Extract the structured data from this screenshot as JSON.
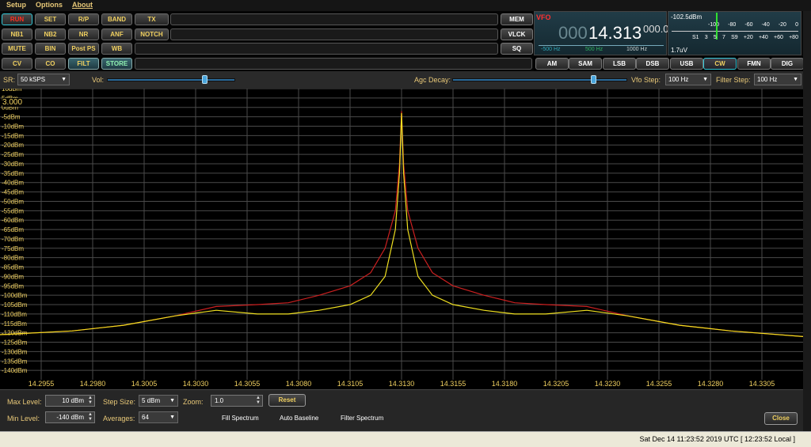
{
  "menu": [
    "Setup",
    "Options",
    "About"
  ],
  "controls": {
    "row1": [
      "RUN",
      "SET",
      "R/P",
      "BAND",
      "TX"
    ],
    "row2": [
      "NB1",
      "NB2",
      "NR",
      "ANF",
      "NOTCH"
    ],
    "row3": [
      "MUTE",
      "BIN",
      "Post PS",
      "WB"
    ],
    "row4": [
      "CV",
      "CO",
      "FILT",
      "STORE"
    ],
    "right": [
      "MEM",
      "VLCK",
      "SQ"
    ]
  },
  "vfo": {
    "label": "VFO",
    "dim": "000",
    "freq": "14.313",
    "sub": "000.0",
    "marks": [
      "-500 Hz",
      "500 Hz",
      "1000 Hz"
    ]
  },
  "smeter": {
    "level": "-102.5dBm",
    "top_scale": [
      "-100",
      "-80",
      "-60",
      "-40",
      "-20",
      "0"
    ],
    "bottom_scale": [
      "S1",
      "3",
      "5",
      "7",
      "S9",
      "+20",
      "+40",
      "+60",
      "+80"
    ],
    "uv": "1.7uV"
  },
  "modes": [
    "AM",
    "SAM",
    "LSB",
    "DSB",
    "USB",
    "CW",
    "FMN",
    "DIG"
  ],
  "active_mode": "CW",
  "ctrl": {
    "sr_label": "SR:",
    "sr_value": "50 kSPS",
    "vol_label": "Vol:",
    "agc_label": "Agc Decay:",
    "vfo_step_label": "Vfo Step:",
    "vfo_step": "100 Hz",
    "filter_step_label": "Filter Step:",
    "filter_step": "100 Hz"
  },
  "levels": {
    "vol": 0.75,
    "agc": 0.8
  },
  "bottom": {
    "max_level_label": "Max Level:",
    "max_level": "10 dBm",
    "min_level_label": "Min Level:",
    "min_level": "-140 dBm",
    "step_size_label": "Step Size:",
    "step_size": "5 dBm",
    "averages_label": "Averages:",
    "averages": "64",
    "zoom_label": "Zoom:",
    "zoom": "1.0",
    "reset": "Reset",
    "fill_spectrum": "Fill Spectrum",
    "auto_baseline": "Auto Baseline",
    "filter_spectrum": "Filter Spectrum",
    "close": "Close"
  },
  "status": "Sat Dec 14 11:23:52 2019 UTC [ 12:23:52 Local ]",
  "colors": {
    "accent": "#f0d060",
    "trace_peak": "#cc2020",
    "trace_avg": "#f0e020",
    "grid": "#4a4a4a"
  },
  "chart_data": {
    "type": "line",
    "marker_value": "3.000",
    "ylim": [
      -145,
      10
    ],
    "xlim": [
      14.2935,
      14.3325
    ],
    "y_ticks": [
      "10dBm",
      "5dBm",
      "0dBm",
      "-5dBm",
      "-10dBm",
      "-15dBm",
      "-20dBm",
      "-25dBm",
      "-30dBm",
      "-35dBm",
      "-40dBm",
      "-45dBm",
      "-50dBm",
      "-55dBm",
      "-60dBm",
      "-65dBm",
      "-70dBm",
      "-75dBm",
      "-80dBm",
      "-85dBm",
      "-90dBm",
      "-95dBm",
      "-100dBm",
      "-105dBm",
      "-110dBm",
      "-115dBm",
      "-120dBm",
      "-125dBm",
      "-130dBm",
      "-135dBm",
      "-140dBm"
    ],
    "x_ticks": [
      "14.2955",
      "14.2980",
      "14.3005",
      "14.3030",
      "14.3055",
      "14.3080",
      "14.3105",
      "14.3130",
      "14.3155",
      "14.3180",
      "14.3205",
      "14.3230",
      "14.3255",
      "14.3280",
      "14.3305"
    ],
    "x_values": [
      14.2955,
      14.298,
      14.3005,
      14.303,
      14.3055,
      14.308,
      14.3105,
      14.313,
      14.3155,
      14.318,
      14.3205,
      14.323,
      14.3255,
      14.328,
      14.3305
    ],
    "series": [
      {
        "color": "#cc2020",
        "points": [
          [
            14.2935,
            -121
          ],
          [
            14.297,
            -119
          ],
          [
            14.2995,
            -116
          ],
          [
            14.302,
            -111
          ],
          [
            14.304,
            -106
          ],
          [
            14.306,
            -105
          ],
          [
            14.3075,
            -104
          ],
          [
            14.309,
            -100
          ],
          [
            14.3105,
            -95
          ],
          [
            14.3115,
            -88
          ],
          [
            14.3122,
            -75
          ],
          [
            14.3127,
            -55
          ],
          [
            14.3129,
            -30
          ],
          [
            14.313,
            -2
          ],
          [
            14.3131,
            -30
          ],
          [
            14.3133,
            -55
          ],
          [
            14.3138,
            -75
          ],
          [
            14.3145,
            -88
          ],
          [
            14.3155,
            -95
          ],
          [
            14.317,
            -100
          ],
          [
            14.3185,
            -104
          ],
          [
            14.32,
            -105
          ],
          [
            14.322,
            -106
          ],
          [
            14.324,
            -111
          ],
          [
            14.3265,
            -116
          ],
          [
            14.329,
            -119
          ],
          [
            14.3325,
            -122
          ]
        ]
      },
      {
        "color": "#f0e020",
        "points": [
          [
            14.2935,
            -121
          ],
          [
            14.297,
            -119
          ],
          [
            14.2995,
            -116
          ],
          [
            14.302,
            -111
          ],
          [
            14.304,
            -108
          ],
          [
            14.306,
            -110
          ],
          [
            14.3075,
            -110
          ],
          [
            14.309,
            -108
          ],
          [
            14.3105,
            -105
          ],
          [
            14.3115,
            -100
          ],
          [
            14.3122,
            -90
          ],
          [
            14.3127,
            -65
          ],
          [
            14.3129,
            -35
          ],
          [
            14.313,
            -3
          ],
          [
            14.3131,
            -35
          ],
          [
            14.3133,
            -65
          ],
          [
            14.3138,
            -90
          ],
          [
            14.3145,
            -100
          ],
          [
            14.3155,
            -105
          ],
          [
            14.317,
            -108
          ],
          [
            14.3185,
            -110
          ],
          [
            14.32,
            -110
          ],
          [
            14.322,
            -108
          ],
          [
            14.324,
            -111
          ],
          [
            14.3265,
            -116
          ],
          [
            14.329,
            -119
          ],
          [
            14.3325,
            -122
          ]
        ]
      }
    ]
  }
}
